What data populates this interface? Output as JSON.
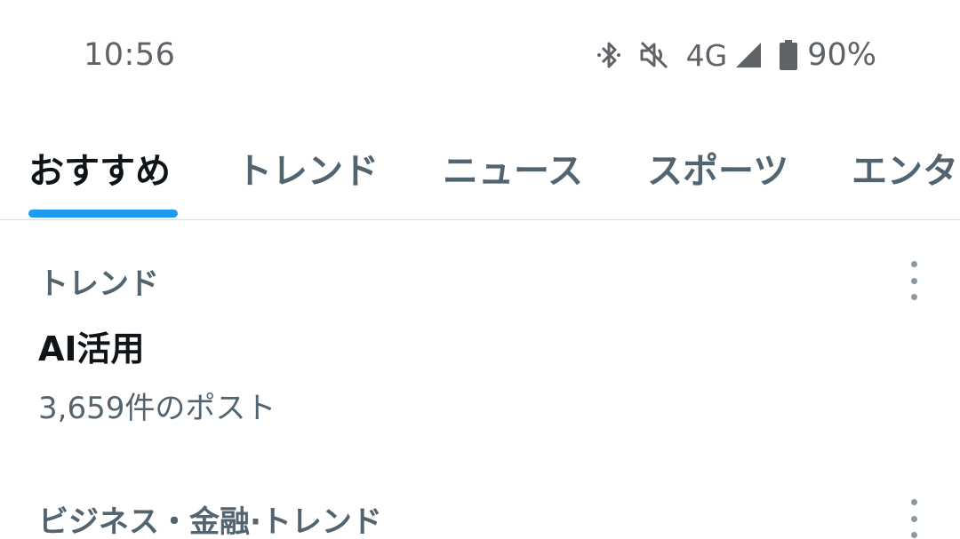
{
  "status_bar": {
    "time": "10:56",
    "network": "4G",
    "battery": "90%",
    "icons": [
      "bluetooth-icon",
      "mute-icon",
      "signal-icon",
      "battery-icon"
    ]
  },
  "tabs": [
    {
      "label": "おすすめ",
      "active": true
    },
    {
      "label": "トレンド",
      "active": false
    },
    {
      "label": "ニュース",
      "active": false
    },
    {
      "label": "スポーツ",
      "active": false
    },
    {
      "label": "エンタ",
      "active": false
    }
  ],
  "trends": [
    {
      "category": "トレンド",
      "title": "AI活用",
      "count": "3,659件のポスト"
    },
    {
      "category": "ビジネス・金融·トレンド"
    }
  ],
  "colors": {
    "accent": "#1d9bf0",
    "text_primary": "#0f1419",
    "text_secondary": "#536471"
  }
}
